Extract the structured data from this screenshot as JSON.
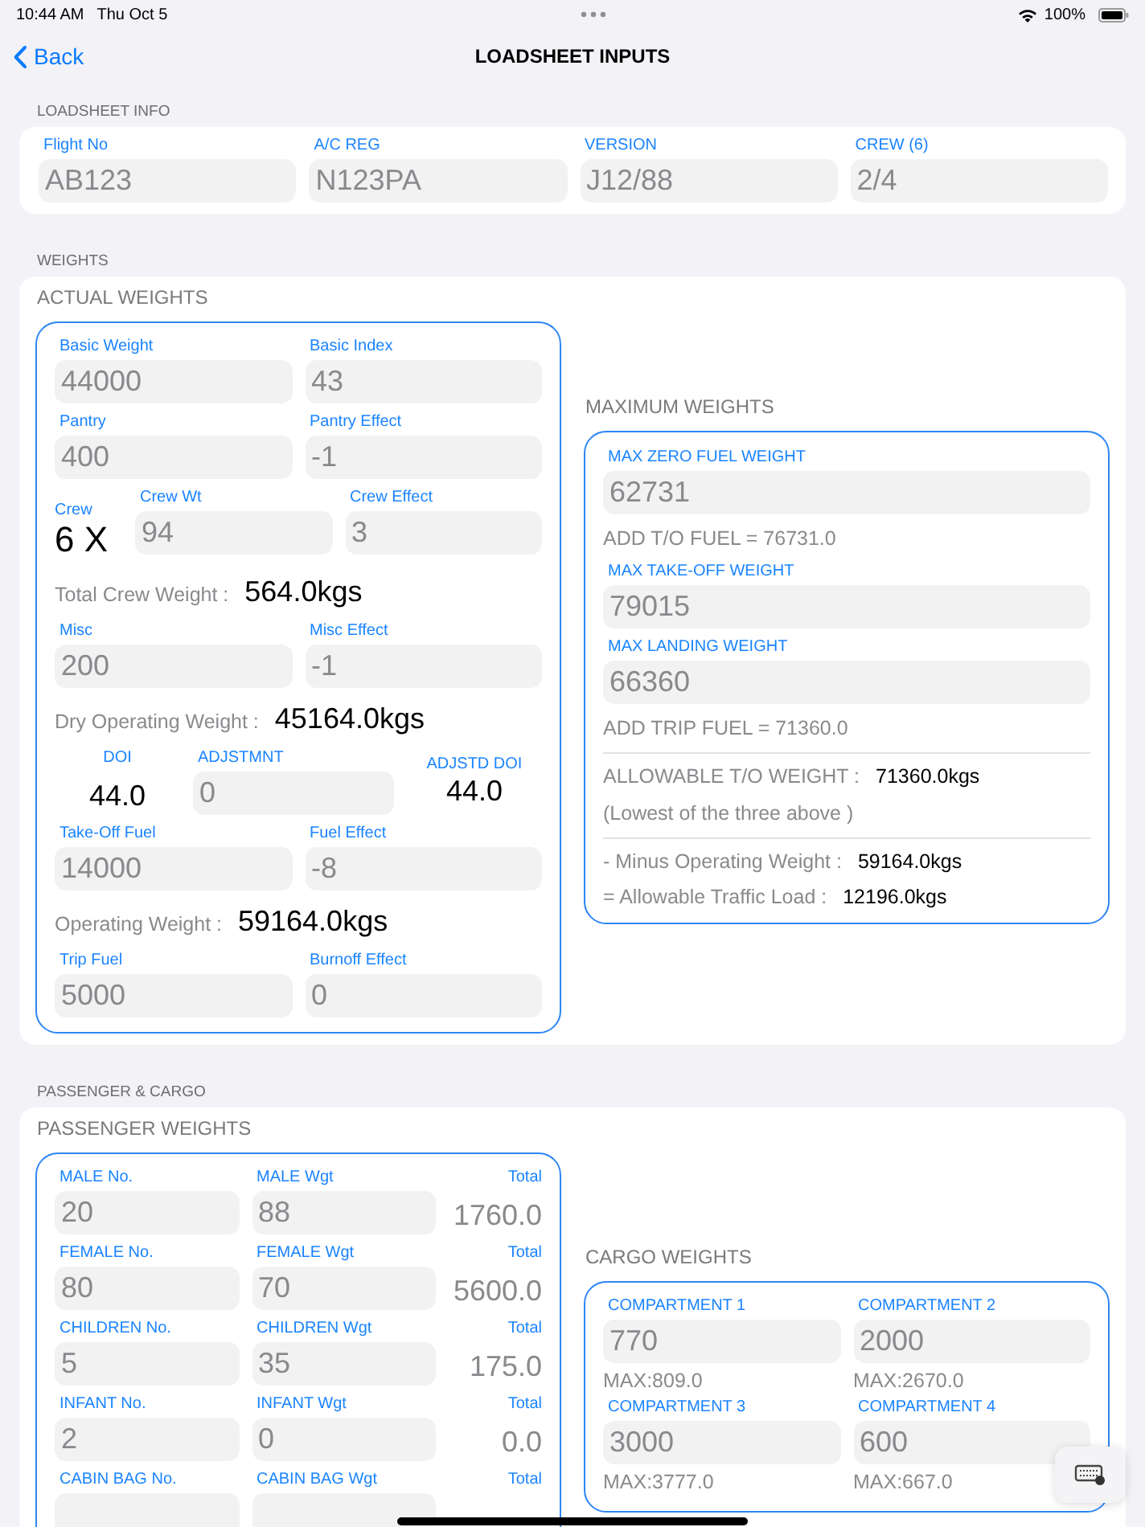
{
  "status_bar": {
    "time": "10:44 AM",
    "date": "Thu Oct 5",
    "battery": "100%"
  },
  "nav": {
    "back": "Back",
    "title": "LOADSHEET INPUTS"
  },
  "loadsheet_info": {
    "header": "LOADSHEET INFO",
    "fields": [
      {
        "label": "Flight No",
        "value": "AB123"
      },
      {
        "label": "A/C REG",
        "value": "N123PA"
      },
      {
        "label": "VERSION",
        "value": "J12/88"
      },
      {
        "label": "CREW (6)",
        "value": "2/4"
      }
    ]
  },
  "weights": {
    "header": "WEIGHTS",
    "actual": {
      "title": "ACTUAL WEIGHTS",
      "rows": [
        {
          "kind": "pair",
          "fields": [
            {
              "label": "Basic Weight",
              "value": "44000"
            },
            {
              "label": "Basic Index",
              "value": "43"
            }
          ]
        },
        {
          "kind": "pair",
          "fields": [
            {
              "label": "Pantry",
              "value": "400"
            },
            {
              "label": "Pantry Effect",
              "value": "-1"
            }
          ]
        },
        {
          "kind": "crew",
          "count_label": "Crew",
          "count": "6 X",
          "fields": [
            {
              "label": "Crew Wt",
              "value": "94"
            },
            {
              "label": "Crew Effect",
              "value": "3"
            }
          ]
        },
        {
          "kind": "total",
          "label": "Total Crew Weight :",
          "value": "564.0kgs"
        },
        {
          "kind": "pair",
          "fields": [
            {
              "label": "Misc",
              "value": "200"
            },
            {
              "label": "Misc Effect",
              "value": "-1"
            }
          ]
        },
        {
          "kind": "total",
          "label": "Dry Operating Weight :",
          "value": "45164.0kgs"
        },
        {
          "kind": "doi",
          "left_label": "DOI",
          "left_value": "44.0",
          "fields": [
            {
              "label": "ADJSTMNT",
              "value": "0"
            }
          ],
          "right_label": "ADJSTD DOI",
          "right_value": "44.0"
        },
        {
          "kind": "pair",
          "fields": [
            {
              "label": "Take-Off Fuel",
              "value": "14000"
            },
            {
              "label": "Fuel Effect",
              "value": "-8"
            }
          ]
        },
        {
          "kind": "total",
          "label": "Operating Weight :",
          "value": "59164.0kgs"
        },
        {
          "kind": "pair",
          "fields": [
            {
              "label": "Trip Fuel",
              "value": "5000"
            },
            {
              "label": "Burnoff Effect",
              "value": "0"
            }
          ]
        }
      ]
    },
    "maximum": {
      "title": "MAXIMUM WEIGHTS",
      "items": [
        {
          "kind": "field",
          "label": "MAX ZERO FUEL WEIGHT",
          "value": "62731"
        },
        {
          "kind": "note",
          "text": "ADD T/O FUEL = 76731.0"
        },
        {
          "kind": "field",
          "label": "MAX TAKE-OFF WEIGHT",
          "value": "79015"
        },
        {
          "kind": "field",
          "label": "MAX LANDING WEIGHT",
          "value": "66360"
        },
        {
          "kind": "note",
          "text": "ADD TRIP FUEL = 71360.0"
        },
        {
          "kind": "divider"
        },
        {
          "kind": "result",
          "label": "ALLOWABLE T/O WEIGHT  :",
          "value": "71360.0kgs"
        },
        {
          "kind": "note",
          "text": "(Lowest of the three above )"
        },
        {
          "kind": "divider"
        },
        {
          "kind": "result",
          "label": "- Minus Operating Weight :",
          "value": "59164.0kgs"
        },
        {
          "kind": "result",
          "label": "= Allowable Traffic Load :",
          "value": "12196.0kgs"
        }
      ]
    }
  },
  "passenger_cargo": {
    "header": "PASSENGER & CARGO",
    "passenger": {
      "title": "PASSENGER WEIGHTS",
      "rows": [
        {
          "fields": [
            {
              "label": "MALE No.",
              "value": "20"
            },
            {
              "label": "MALE Wgt",
              "value": "88"
            }
          ],
          "total_label": "Total",
          "total": "1760.0"
        },
        {
          "fields": [
            {
              "label": "FEMALE No.",
              "value": "80"
            },
            {
              "label": "FEMALE Wgt",
              "value": "70"
            }
          ],
          "total_label": "Total",
          "total": "5600.0"
        },
        {
          "fields": [
            {
              "label": "CHILDREN No.",
              "value": "5"
            },
            {
              "label": "CHILDREN Wgt",
              "value": "35"
            }
          ],
          "total_label": "Total",
          "total": "175.0"
        },
        {
          "fields": [
            {
              "label": "INFANT No.",
              "value": "2"
            },
            {
              "label": "INFANT Wgt",
              "value": "0"
            }
          ],
          "total_label": "Total",
          "total": "0.0"
        },
        {
          "fields": [
            {
              "label": "CABIN BAG No."
            },
            {
              "label": "CABIN BAG Wgt"
            }
          ],
          "total_label": "Total"
        }
      ]
    },
    "cargo": {
      "title": "CARGO WEIGHTS",
      "compartments": [
        {
          "label": "COMPARTMENT 1",
          "value": "770",
          "max": "MAX:809.0"
        },
        {
          "label": "COMPARTMENT 2",
          "value": "2000",
          "max": "MAX:2670.0"
        },
        {
          "label": "COMPARTMENT 3",
          "value": "3000",
          "max": "MAX:3777.0"
        },
        {
          "label": "COMPARTMENT 4",
          "value": "600",
          "max": "MAX:667.0"
        }
      ]
    }
  }
}
